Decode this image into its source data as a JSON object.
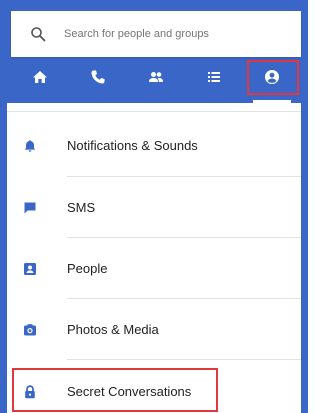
{
  "search": {
    "placeholder": "Search for people and groups"
  },
  "tabs": [
    {
      "name": "home-tab",
      "icon": "home-icon"
    },
    {
      "name": "calls-tab",
      "icon": "phone-icon"
    },
    {
      "name": "people-tab",
      "icon": "people-icon"
    },
    {
      "name": "list-tab",
      "icon": "list-icon"
    },
    {
      "name": "profile-tab",
      "icon": "account-circle-icon",
      "active": true
    }
  ],
  "settings": {
    "items": [
      {
        "label": "Notifications & Sounds",
        "icon": "bell-icon"
      },
      {
        "label": "SMS",
        "icon": "chat-bubble-icon"
      },
      {
        "label": "People",
        "icon": "person-card-icon"
      },
      {
        "label": "Photos & Media",
        "icon": "camera-icon"
      },
      {
        "label": "Secret Conversations",
        "icon": "lock-icon"
      }
    ]
  },
  "colors": {
    "brand": "#3a67c7",
    "highlight": "#e0383e"
  }
}
